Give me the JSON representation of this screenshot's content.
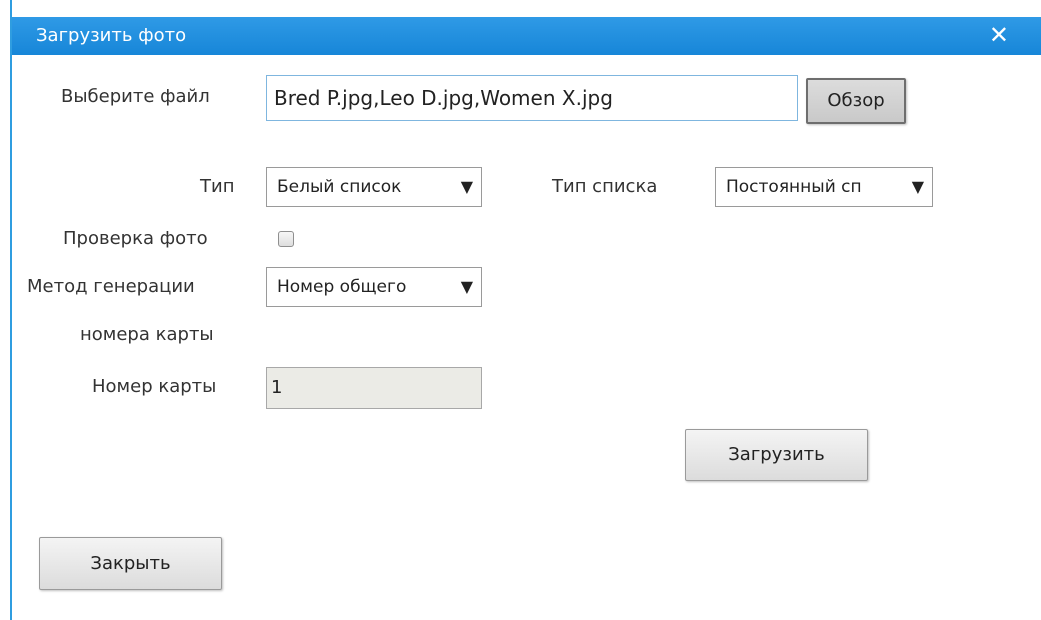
{
  "dialog": {
    "title": "Загрузить фото",
    "close_symbol": "✕"
  },
  "form": {
    "file_label": "Выберите файл",
    "file_value": "Bred P.jpg,Leo D.jpg,Women X.jpg",
    "browse_label": "Обзор",
    "type_label": "Тип",
    "type_value": "Белый список",
    "list_type_label": "Тип списка",
    "list_type_value": "Постоянный сп",
    "photo_check_label": "Проверка фото",
    "photo_check_checked": false,
    "gen_method_label_line1": "Метод генерации",
    "gen_method_label_line2": "номера карты",
    "gen_method_value": "Номер общего",
    "card_number_label": "Номер карты",
    "card_number_value": "1",
    "arrow_symbol": "▼"
  },
  "actions": {
    "upload_label": "Загрузить",
    "close_label": "Закрыть"
  }
}
